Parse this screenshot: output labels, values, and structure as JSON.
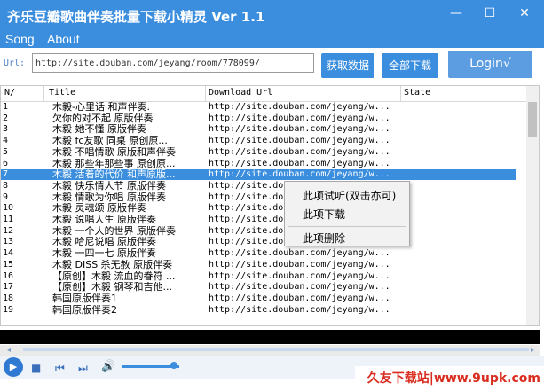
{
  "window": {
    "title": "齐乐豆瓣歌曲伴奏批量下载小精灵 Ver 1.1",
    "minimize_glyph": "—",
    "maximize_glyph": "☐",
    "close_glyph": "✕"
  },
  "menu": {
    "items": [
      "Song",
      "About"
    ]
  },
  "url_bar": {
    "label": "Url:",
    "value": "http://site.douban.com/jeyang/room/778099/"
  },
  "buttons": {
    "fetch": "获取数据",
    "download_all": "全部下载",
    "login": "Login√"
  },
  "table": {
    "columns": [
      "N/",
      "Title",
      "Download Url",
      "State"
    ],
    "selected_row": 7,
    "rows": [
      {
        "no": "1",
        "title": "木毅-心里话 和声伴奏.",
        "url": "http://site.douban.com/jeyang/w..."
      },
      {
        "no": "2",
        "title": "欠你的对不起 原版伴奏",
        "url": "http://site.douban.com/jeyang/w..."
      },
      {
        "no": "3",
        "title": "木毅 她不懂 原版伴奏",
        "url": "http://site.douban.com/jeyang/w..."
      },
      {
        "no": "4",
        "title": "木毅 fc友歌 同桌 原创原...",
        "url": "http://site.douban.com/jeyang/w..."
      },
      {
        "no": "5",
        "title": "木毅  不唱情歌 原版和声伴奏",
        "url": "http://site.douban.com/jeyang/w..."
      },
      {
        "no": "6",
        "title": "木毅 那些年那些事 原创原...",
        "url": "http://site.douban.com/jeyang/w..."
      },
      {
        "no": "7",
        "title": "木毅 活着的代价 和声原版...",
        "url": "http://site.douban.com/jeyang/w..."
      },
      {
        "no": "8",
        "title": "木毅 快乐情人节 原版伴奏",
        "url": "http://site.do"
      },
      {
        "no": "9",
        "title": "木毅 情歌为你唱 原版伴奏",
        "url": "http://site.do"
      },
      {
        "no": "10",
        "title": "木毅 灵魂颂 原版伴奏",
        "url": "http://site.do"
      },
      {
        "no": "11",
        "title": "木毅 说唱人生 原版伴奏",
        "url": "http://site.do"
      },
      {
        "no": "12",
        "title": "木毅 一个人的世界 原版伴奏",
        "url": "http://site.do"
      },
      {
        "no": "13",
        "title": "木毅 哈尼说唱 原版伴奏",
        "url": "http://site.do"
      },
      {
        "no": "14",
        "title": "木毅 一四一七 原版伴奏",
        "url": "http://site.douban.com/jeyang/w..."
      },
      {
        "no": "15",
        "title": "木毅 DISS 杀无赦 原版伴奏",
        "url": "http://site.douban.com/jeyang/w..."
      },
      {
        "no": "16",
        "title": "【原创】木毅 流血的眷符 ...",
        "url": "http://site.douban.com/jeyang/w..."
      },
      {
        "no": "17",
        "title": "【原创】木毅 钢琴和吉他...",
        "url": "http://site.douban.com/jeyang/w..."
      },
      {
        "no": "18",
        "title": "韩国原版伴奏1",
        "url": "http://site.douban.com/jeyang/w..."
      },
      {
        "no": "19",
        "title": "韩国原版伴奏2",
        "url": "http://site.douban.com/jeyang/w..."
      }
    ]
  },
  "context_menu": {
    "items": [
      "此项试听(双击亦可)",
      "此项下载",
      "此项删除"
    ]
  },
  "player": {
    "play_icon": "play-icon",
    "stop_icon": "stop-icon",
    "prev_icon": "prev-icon",
    "next_icon": "next-icon",
    "volume_icon": "volume-icon",
    "volume_level": 0.9
  },
  "watermark": "久友下载站|www.9upk.com",
  "colors": {
    "accent": "#3b8ede",
    "watermark": "#d92d20"
  }
}
